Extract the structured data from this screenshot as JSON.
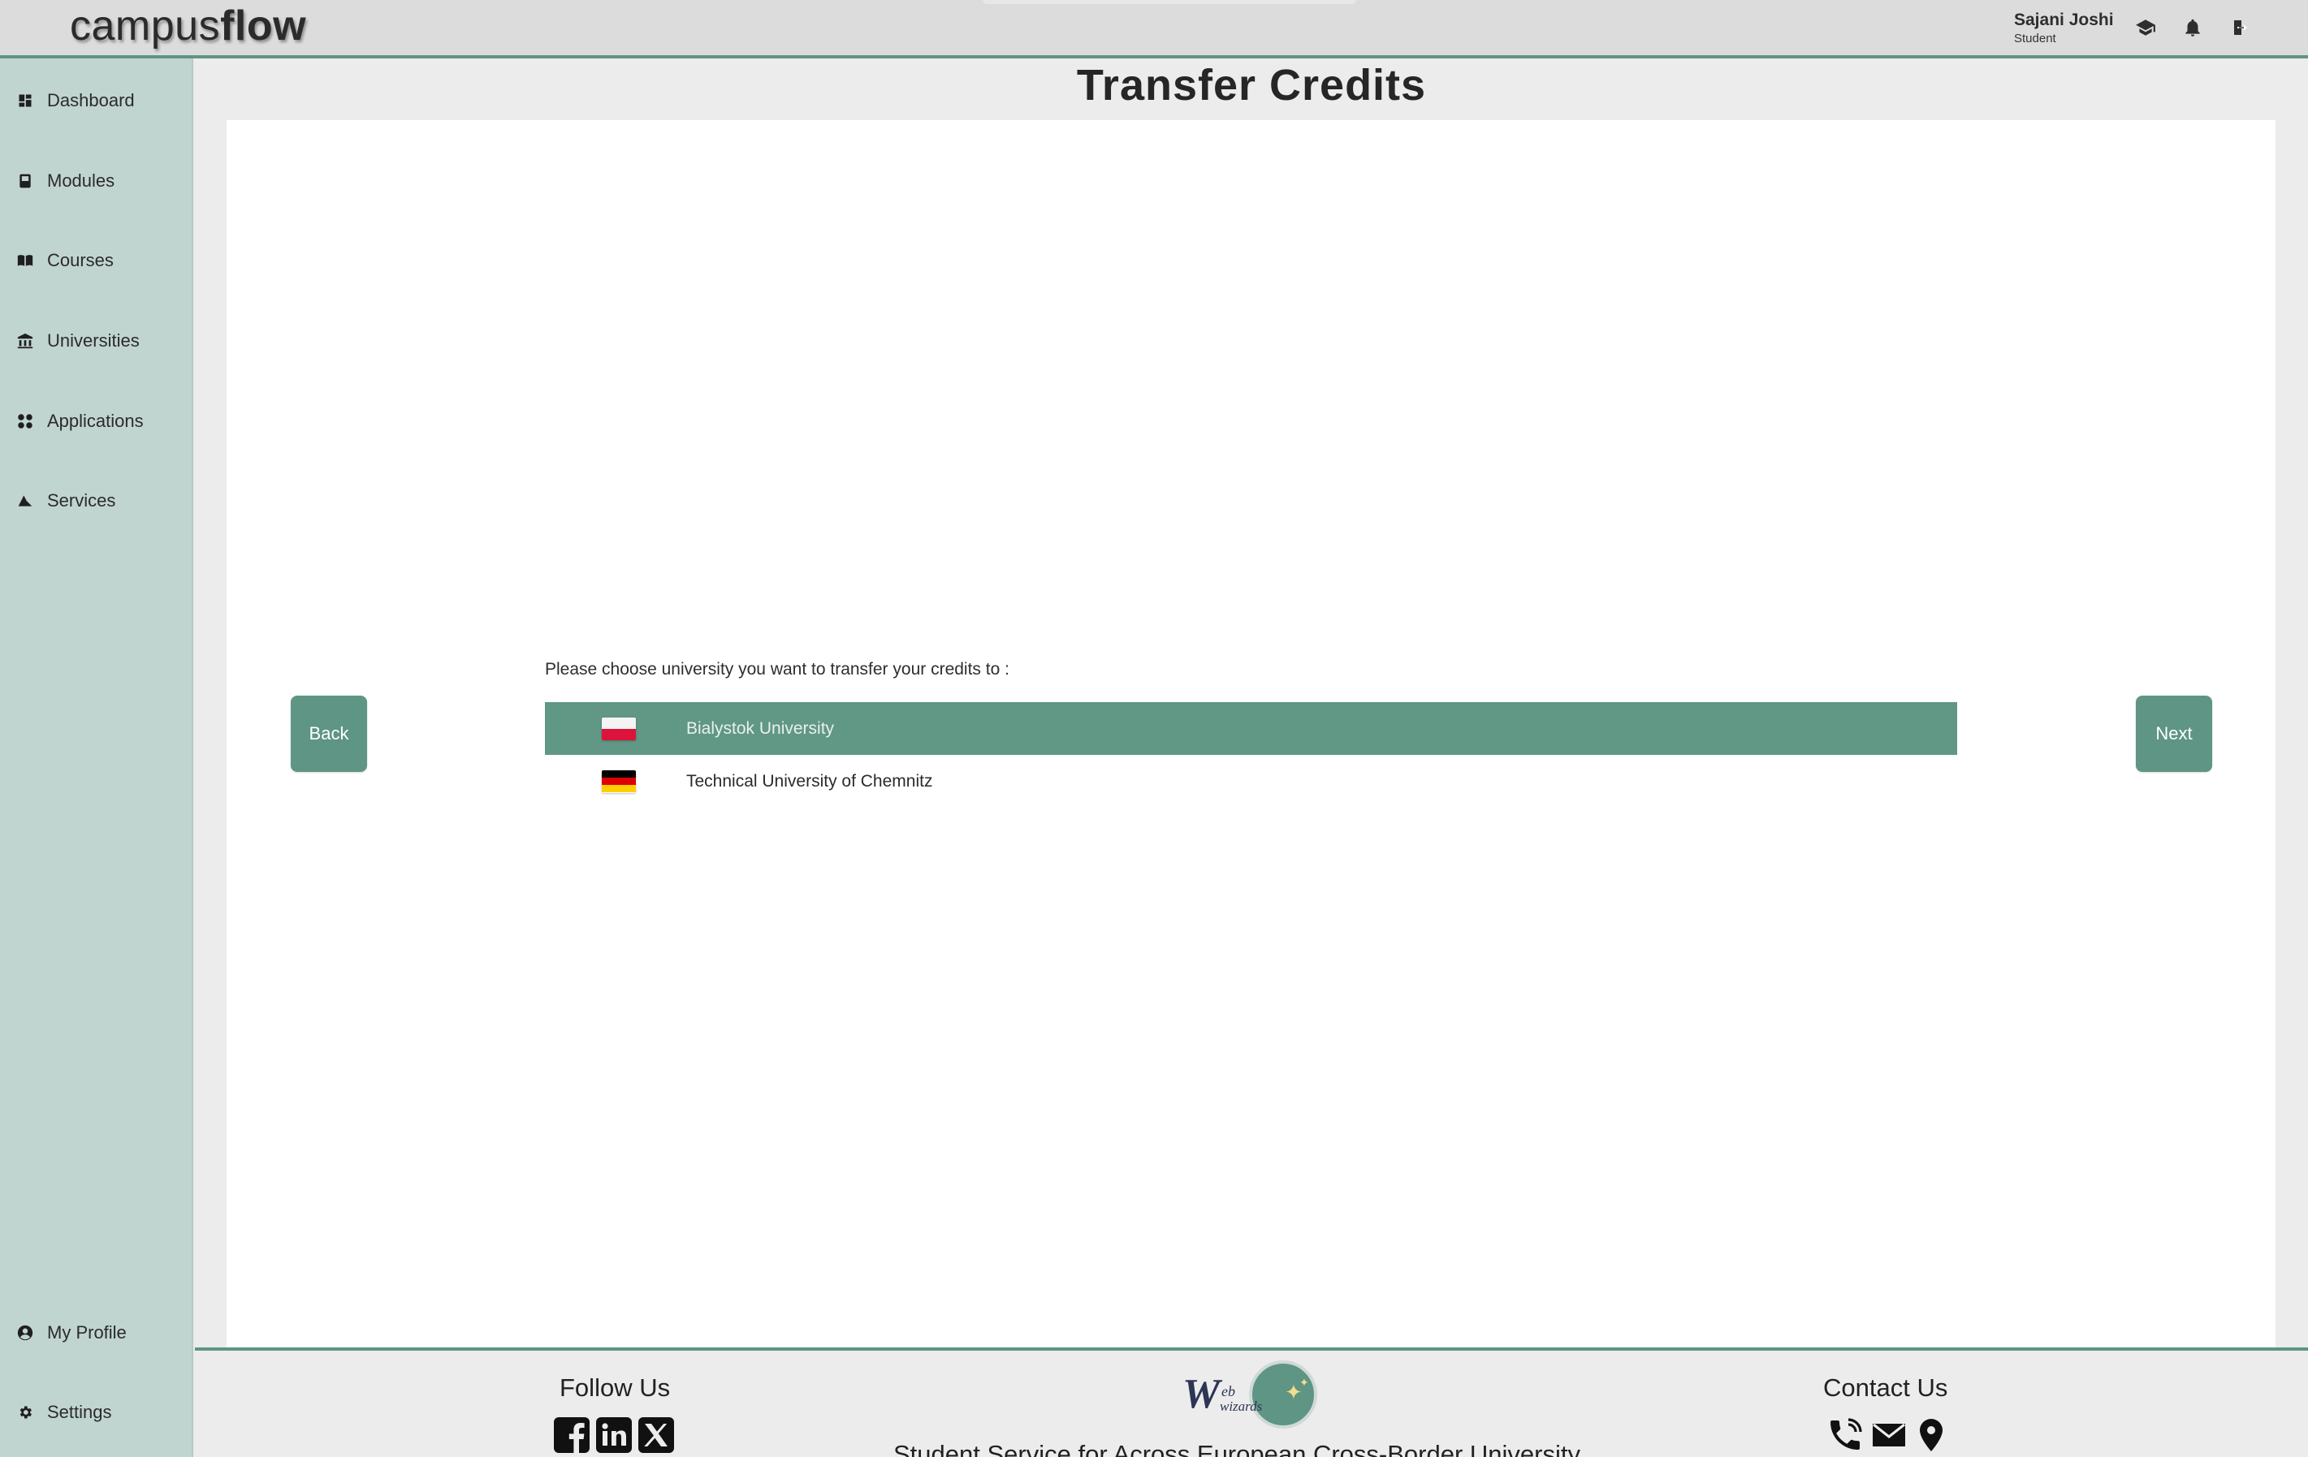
{
  "header": {
    "logo_light": "campus",
    "logo_bold": "flow",
    "user_name": "Sajani Joshi",
    "user_role": "Student",
    "icons": [
      "graduation-cap-icon",
      "bell-icon",
      "logout-icon"
    ]
  },
  "sidebar": {
    "items": [
      {
        "label": "Dashboard",
        "icon": "dashboard-icon"
      },
      {
        "label": "Modules",
        "icon": "book-icon"
      },
      {
        "label": "Courses",
        "icon": "open-book-icon"
      },
      {
        "label": "Universities",
        "icon": "university-icon"
      },
      {
        "label": "Applications",
        "icon": "apps-icon"
      },
      {
        "label": "Services",
        "icon": "services-icon"
      }
    ],
    "bottom_items": [
      {
        "label": "My Profile",
        "icon": "profile-icon"
      },
      {
        "label": "Settings",
        "icon": "gear-icon"
      }
    ]
  },
  "main": {
    "title": "Transfer Credits",
    "prompt": "Please choose university you want to transfer your credits to :",
    "back_label": "Back",
    "next_label": "Next",
    "universities": [
      {
        "name": "Bialystok University",
        "flag": "poland",
        "selected": true
      },
      {
        "name": "Technical University of Chemnitz",
        "flag": "germany",
        "selected": false
      }
    ]
  },
  "footer": {
    "follow_us": "Follow Us",
    "contact_us": "Contact Us",
    "tagline": "Student Service for Across European Cross-Border University",
    "logo_text": "Web wizards",
    "social_icons": [
      "facebook-icon",
      "linkedin-icon",
      "x-icon"
    ],
    "contact_icons": [
      "phone-icon",
      "mail-icon",
      "location-icon"
    ]
  },
  "colors": {
    "accent": "#5e9584",
    "sidebar_bg": "#c1d5d0",
    "header_bg": "#dcdcdc",
    "selected_row": "#619785"
  }
}
